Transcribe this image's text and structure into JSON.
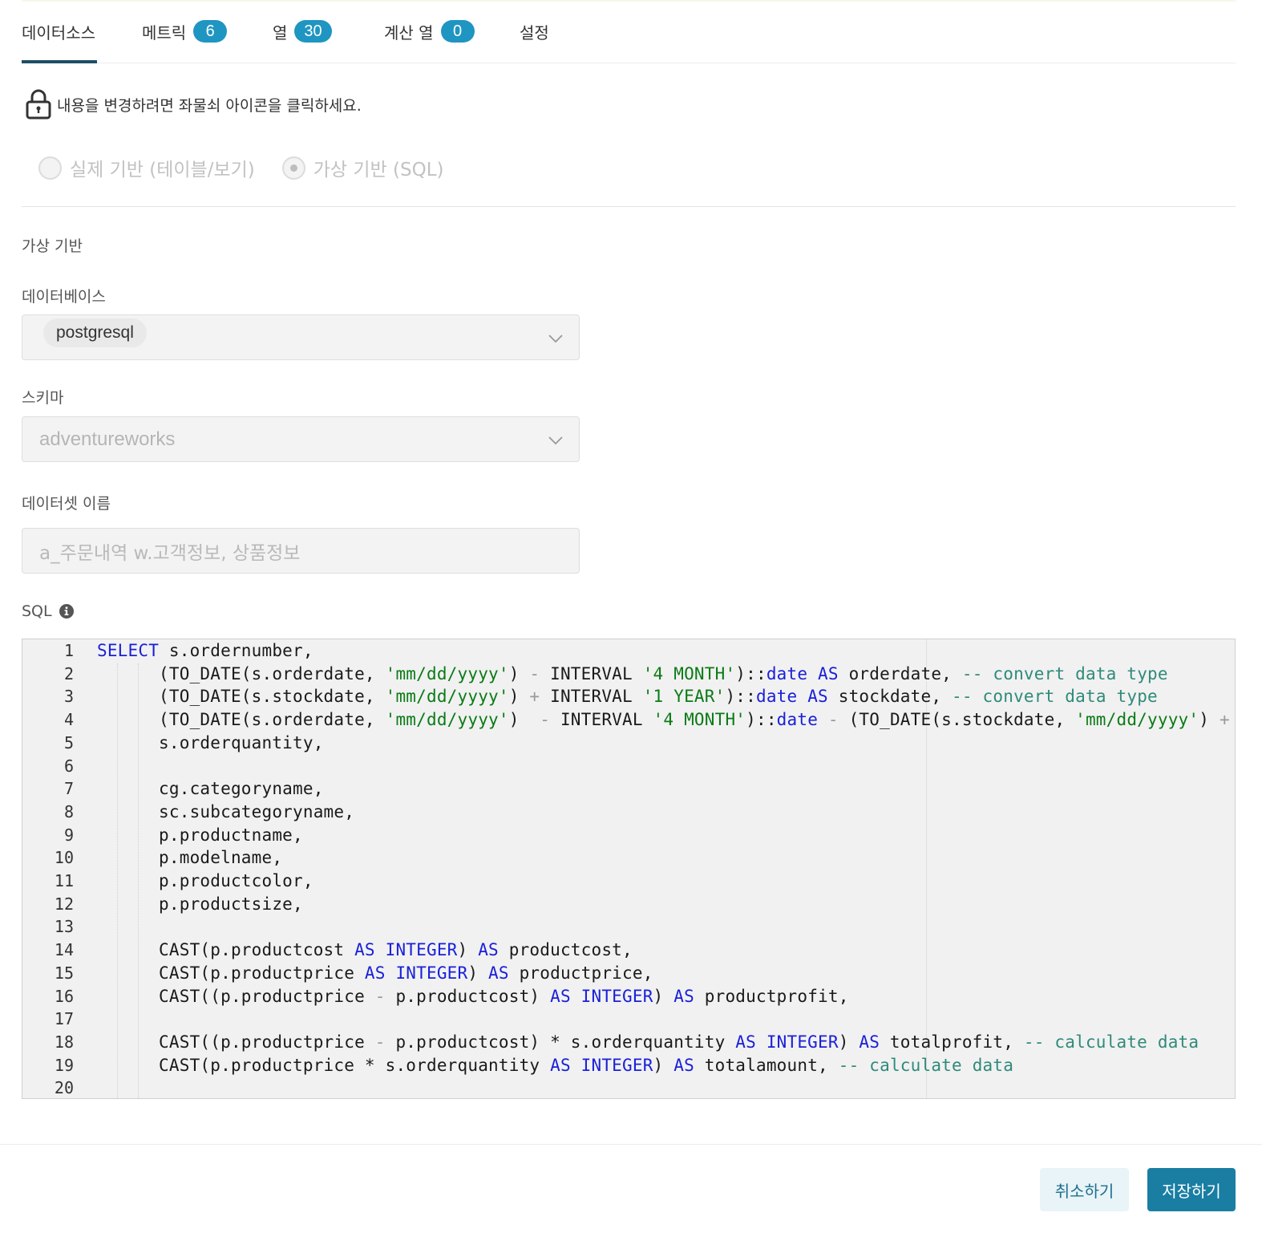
{
  "tabs": [
    {
      "label": "데이터소스",
      "count": null,
      "active": true
    },
    {
      "label": "메트릭",
      "count": "6"
    },
    {
      "label": "열",
      "count": "30"
    },
    {
      "label": "계산 열",
      "count": "0"
    },
    {
      "label": "설정",
      "count": null
    }
  ],
  "notice": {
    "text": "내용을 변경하려면 좌물쇠 아이콘을 클릭하세요.",
    "icon": "lock-icon"
  },
  "source_type": {
    "options": [
      {
        "label": "실제 기반 (테이블/보기)",
        "selected": false
      },
      {
        "label": "가상 기반 (SQL)",
        "selected": true
      }
    ],
    "disabled": true
  },
  "section_title": "가상 기반",
  "database": {
    "label": "데이터베이스",
    "value": "postgresql"
  },
  "schema": {
    "label": "스키마",
    "value": "adventureworks"
  },
  "dataset_name": {
    "label": "데이터셋 이름",
    "value": "a_주문내역 w.고객정보, 상품정보"
  },
  "sql": {
    "label": "SQL",
    "icon": "info-icon",
    "line_numbers": [
      "1",
      "2",
      "3",
      "4",
      "5",
      "6",
      "7",
      "8",
      "9",
      "10",
      "11",
      "12",
      "13",
      "14",
      "15",
      "16",
      "17",
      "18",
      "19",
      "20"
    ],
    "lines": [
      [
        {
          "t": "kw",
          "v": "SELECT"
        },
        {
          "t": "n",
          "v": " s.ordernumber,"
        }
      ],
      [
        {
          "t": "n",
          "v": "      (TO_DATE(s.orderdate, "
        },
        {
          "t": "str",
          "v": "'mm/dd/yyyy'"
        },
        {
          "t": "n",
          "v": ") "
        },
        {
          "t": "op",
          "v": "-"
        },
        {
          "t": "n",
          "v": " INTERVAL "
        },
        {
          "t": "str",
          "v": "'4 MONTH'"
        },
        {
          "t": "n",
          "v": ")::"
        },
        {
          "t": "kw",
          "v": "date"
        },
        {
          "t": "n",
          "v": " "
        },
        {
          "t": "kw",
          "v": "AS"
        },
        {
          "t": "n",
          "v": " orderdate, "
        },
        {
          "t": "cmt",
          "v": "-- convert data type"
        }
      ],
      [
        {
          "t": "n",
          "v": "      (TO_DATE(s.stockdate, "
        },
        {
          "t": "str",
          "v": "'mm/dd/yyyy'"
        },
        {
          "t": "n",
          "v": ") "
        },
        {
          "t": "op",
          "v": "+"
        },
        {
          "t": "n",
          "v": " INTERVAL "
        },
        {
          "t": "str",
          "v": "'1 YEAR'"
        },
        {
          "t": "n",
          "v": ")::"
        },
        {
          "t": "kw",
          "v": "date"
        },
        {
          "t": "n",
          "v": " "
        },
        {
          "t": "kw",
          "v": "AS"
        },
        {
          "t": "n",
          "v": " stockdate, "
        },
        {
          "t": "cmt",
          "v": "-- convert data type"
        }
      ],
      [
        {
          "t": "n",
          "v": "      (TO_DATE(s.orderdate, "
        },
        {
          "t": "str",
          "v": "'mm/dd/yyyy'"
        },
        {
          "t": "n",
          "v": ")  "
        },
        {
          "t": "op",
          "v": "-"
        },
        {
          "t": "n",
          "v": " INTERVAL "
        },
        {
          "t": "str",
          "v": "'4 MONTH'"
        },
        {
          "t": "n",
          "v": ")::"
        },
        {
          "t": "kw",
          "v": "date"
        },
        {
          "t": "n",
          "v": " "
        },
        {
          "t": "op",
          "v": "-"
        },
        {
          "t": "n",
          "v": " (TO_DATE(s.stockdate, "
        },
        {
          "t": "str",
          "v": "'mm/dd/yyyy'"
        },
        {
          "t": "n",
          "v": ") "
        },
        {
          "t": "op",
          "v": "+"
        }
      ],
      [
        {
          "t": "n",
          "v": "      s.orderquantity,"
        }
      ],
      [
        {
          "t": "n",
          "v": ""
        }
      ],
      [
        {
          "t": "n",
          "v": "      cg.categoryname,"
        }
      ],
      [
        {
          "t": "n",
          "v": "      sc.subcategoryname,"
        }
      ],
      [
        {
          "t": "n",
          "v": "      p.productname,"
        }
      ],
      [
        {
          "t": "n",
          "v": "      p.modelname,"
        }
      ],
      [
        {
          "t": "n",
          "v": "      p.productcolor,"
        }
      ],
      [
        {
          "t": "n",
          "v": "      p.productsize,"
        }
      ],
      [
        {
          "t": "n",
          "v": ""
        }
      ],
      [
        {
          "t": "n",
          "v": "      CAST(p.productcost "
        },
        {
          "t": "kw",
          "v": "AS"
        },
        {
          "t": "n",
          "v": " "
        },
        {
          "t": "kw",
          "v": "INTEGER"
        },
        {
          "t": "n",
          "v": ") "
        },
        {
          "t": "kw",
          "v": "AS"
        },
        {
          "t": "n",
          "v": " productcost,"
        }
      ],
      [
        {
          "t": "n",
          "v": "      CAST(p.productprice "
        },
        {
          "t": "kw",
          "v": "AS"
        },
        {
          "t": "n",
          "v": " "
        },
        {
          "t": "kw",
          "v": "INTEGER"
        },
        {
          "t": "n",
          "v": ") "
        },
        {
          "t": "kw",
          "v": "AS"
        },
        {
          "t": "n",
          "v": " productprice,"
        }
      ],
      [
        {
          "t": "n",
          "v": "      CAST((p.productprice "
        },
        {
          "t": "op",
          "v": "-"
        },
        {
          "t": "n",
          "v": " p.productcost) "
        },
        {
          "t": "kw",
          "v": "AS"
        },
        {
          "t": "n",
          "v": " "
        },
        {
          "t": "kw",
          "v": "INTEGER"
        },
        {
          "t": "n",
          "v": ") "
        },
        {
          "t": "kw",
          "v": "AS"
        },
        {
          "t": "n",
          "v": " productprofit,"
        }
      ],
      [
        {
          "t": "n",
          "v": ""
        }
      ],
      [
        {
          "t": "n",
          "v": "      CAST((p.productprice "
        },
        {
          "t": "op",
          "v": "-"
        },
        {
          "t": "n",
          "v": " p.productcost) * s.orderquantity "
        },
        {
          "t": "kw",
          "v": "AS"
        },
        {
          "t": "n",
          "v": " "
        },
        {
          "t": "kw",
          "v": "INTEGER"
        },
        {
          "t": "n",
          "v": ") "
        },
        {
          "t": "kw",
          "v": "AS"
        },
        {
          "t": "n",
          "v": " totalprofit, "
        },
        {
          "t": "cmt",
          "v": "-- calculate data"
        }
      ],
      [
        {
          "t": "n",
          "v": "      CAST(p.productprice * s.orderquantity "
        },
        {
          "t": "kw",
          "v": "AS"
        },
        {
          "t": "n",
          "v": " "
        },
        {
          "t": "kw",
          "v": "INTEGER"
        },
        {
          "t": "n",
          "v": ") "
        },
        {
          "t": "kw",
          "v": "AS"
        },
        {
          "t": "n",
          "v": " totalamount, "
        },
        {
          "t": "cmt",
          "v": "-- calculate data"
        }
      ],
      [
        {
          "t": "n",
          "v": ""
        }
      ]
    ]
  },
  "buttons": {
    "cancel": "취소하기",
    "save": "저장하기"
  },
  "colors": {
    "accent": "#1a7ea3",
    "badge": "#1f95c2",
    "tab_underline": "#1d4f66",
    "keyword": "#1a20d8",
    "string": "#0b7b16",
    "comment": "#2f8a7a"
  }
}
